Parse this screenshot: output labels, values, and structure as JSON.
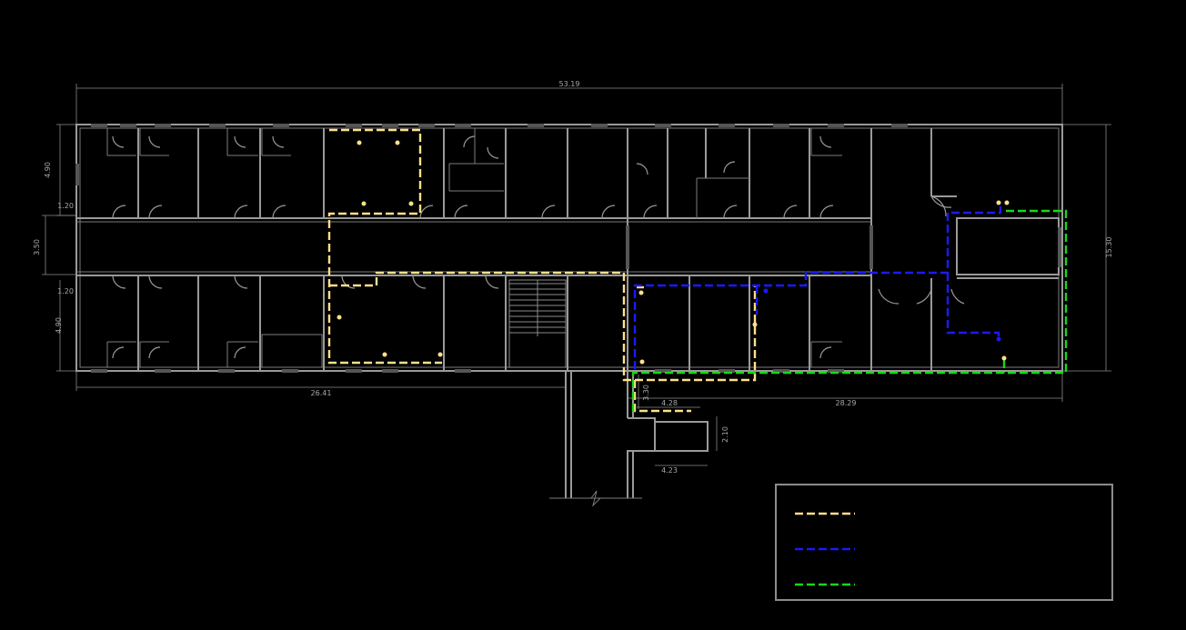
{
  "dimensions": {
    "total_length": "53.19",
    "left_length": "26.41",
    "right_length": "28.29",
    "total_depth": "15.30",
    "north_rooms": "4.90",
    "south_rooms": "4.90",
    "corridor": "3.50",
    "wall_top": "1.20",
    "wall_bottom": "1.20",
    "annex_width_top": "4.28",
    "annex_width_bottom": "4.23",
    "annex_depth": "2.10",
    "annex_offset": "3.30"
  },
  "colors": {
    "yellow_route": "#ffe08a",
    "blue_route": "#1a1aff",
    "green_route": "#19d619",
    "walls": "#9a9a9a",
    "background": "#000000"
  },
  "legend": {
    "items": [
      {
        "color_key": "yellow_route",
        "label": ""
      },
      {
        "color_key": "blue_route",
        "label": ""
      },
      {
        "color_key": "green_route",
        "label": ""
      }
    ]
  }
}
